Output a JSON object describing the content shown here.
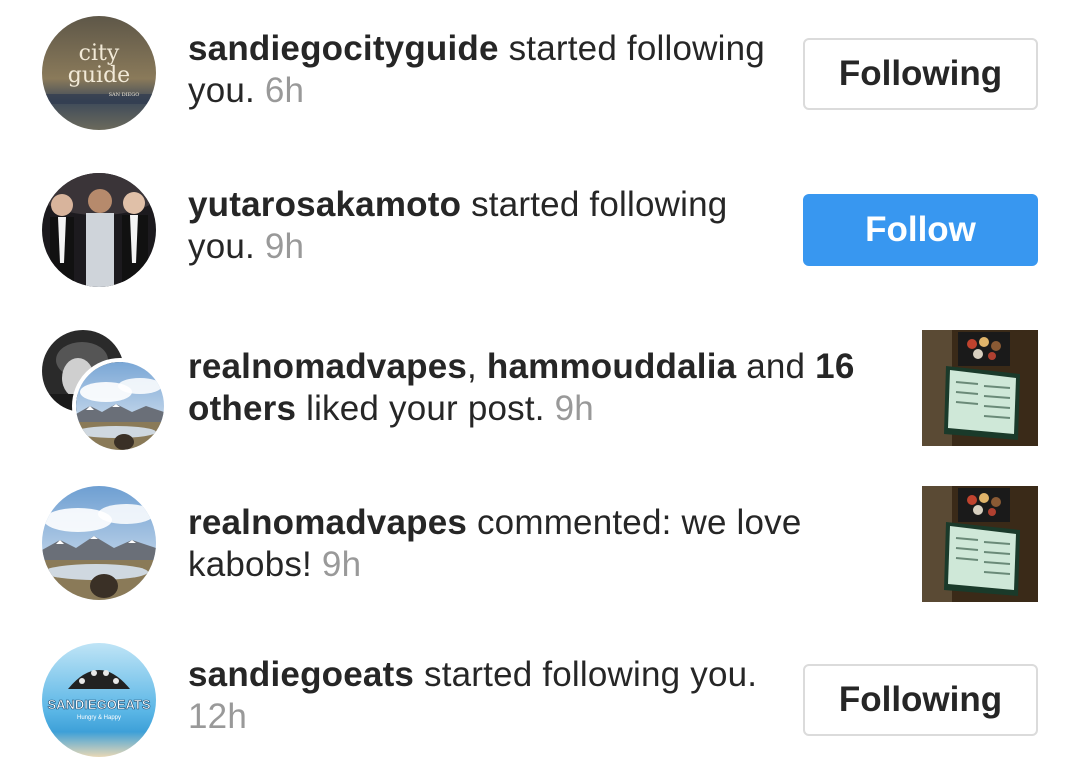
{
  "notifications": [
    {
      "username": "sandiegocityguide",
      "action": " started following you. ",
      "time": "6h",
      "button_label": "Following",
      "avatar_text": {
        "line1": "city",
        "line2": "guide",
        "line3": "SAN DIEGO"
      }
    },
    {
      "username": "yutarosakamoto",
      "action": " started following you. ",
      "time": "9h",
      "button_label": "Follow"
    },
    {
      "username": "realnomadvapes",
      "sep": ", ",
      "username2": "hammouddalia",
      "and": " and ",
      "others_count": "16 others",
      "action": " liked your post. ",
      "time": "9h"
    },
    {
      "username": "realnomadvapes",
      "action": " commented: we love kabobs! ",
      "time": "9h"
    },
    {
      "username": "sandiegoeats",
      "action": " started following you. ",
      "time": "12h",
      "button_label": "Following",
      "avatar_text": {
        "line1": "SANDIEGOEATS",
        "line2": "Hungry & Happy"
      }
    }
  ],
  "colors": {
    "follow_blue": "#3897f0",
    "time_gray": "#999999",
    "text": "#262626",
    "border": "#dbdbdb"
  }
}
